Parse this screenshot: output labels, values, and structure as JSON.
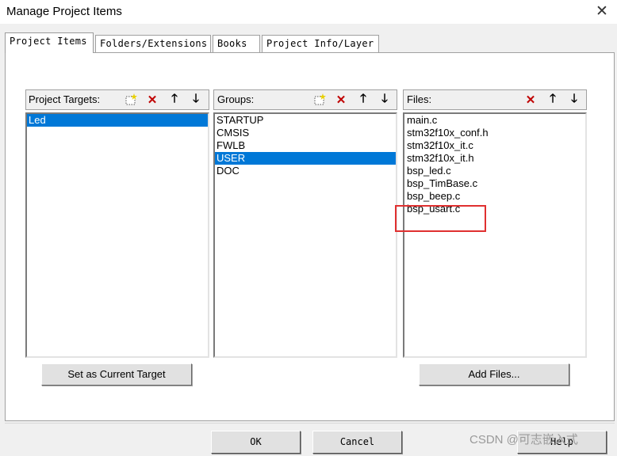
{
  "window": {
    "title": "Manage Project Items",
    "close_glyph": "✕"
  },
  "tabs": [
    "Project Items",
    "Folders/Extensions",
    "Books",
    "Project Info/Layer"
  ],
  "targets": {
    "label": "Project Targets:",
    "items": [
      "Led"
    ],
    "selected": "Led"
  },
  "groups": {
    "label": "Groups:",
    "items": [
      "STARTUP",
      "CMSIS",
      "FWLB",
      "USER",
      "DOC"
    ],
    "selected": "USER"
  },
  "files": {
    "label": "Files:",
    "items": [
      "main.c",
      "stm32f10x_conf.h",
      "stm32f10x_it.c",
      "stm32f10x_it.h",
      "bsp_led.c",
      "bsp_TimBase.c",
      "bsp_beep.c",
      "bsp_usart.c"
    ],
    "highlighted": "bsp_usart.c"
  },
  "buttons": {
    "set_target": "Set as Current Target",
    "add_files": "Add Files...",
    "ok": "OK",
    "cancel": "Cancel",
    "help": "Help"
  },
  "toolbar_icons": {
    "new": "new-item-icon",
    "delete": "delete-icon",
    "up": "move-up-icon",
    "down": "move-down-icon"
  },
  "colors": {
    "selection": "#0078d7",
    "highlight_box": "#e03030",
    "delete": "#c00000"
  },
  "watermark": "CSDN @可志嵌入式"
}
